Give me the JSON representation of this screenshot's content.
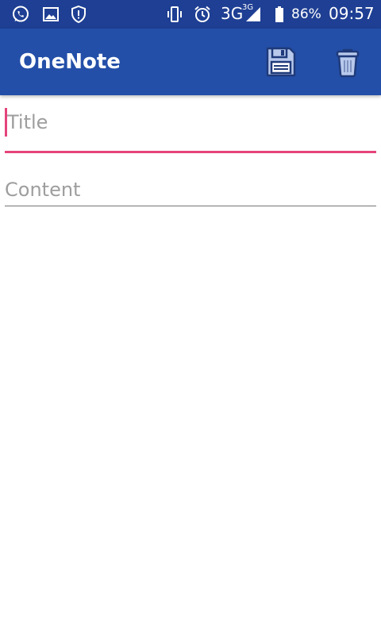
{
  "status_bar": {
    "network": "3G",
    "network_sup": "3G",
    "battery": "86%",
    "time": "09:57",
    "icons": [
      "whatsapp-icon",
      "gallery-icon",
      "shield-alert-icon",
      "vibrate-icon",
      "alarm-icon",
      "signal-icon",
      "battery-icon"
    ]
  },
  "app_bar": {
    "title": "OneNote",
    "actions": [
      "save-icon",
      "delete-icon"
    ]
  },
  "form": {
    "title_placeholder": "Title",
    "title_value": "",
    "content_placeholder": "Content",
    "content_value": ""
  },
  "colors": {
    "status_bar": "#1e3f93",
    "app_bar": "#234fa8",
    "accent": "#e5437c",
    "action_icon_fill": "#b8c9ec",
    "action_icon_stroke": "#1f3a7a"
  }
}
